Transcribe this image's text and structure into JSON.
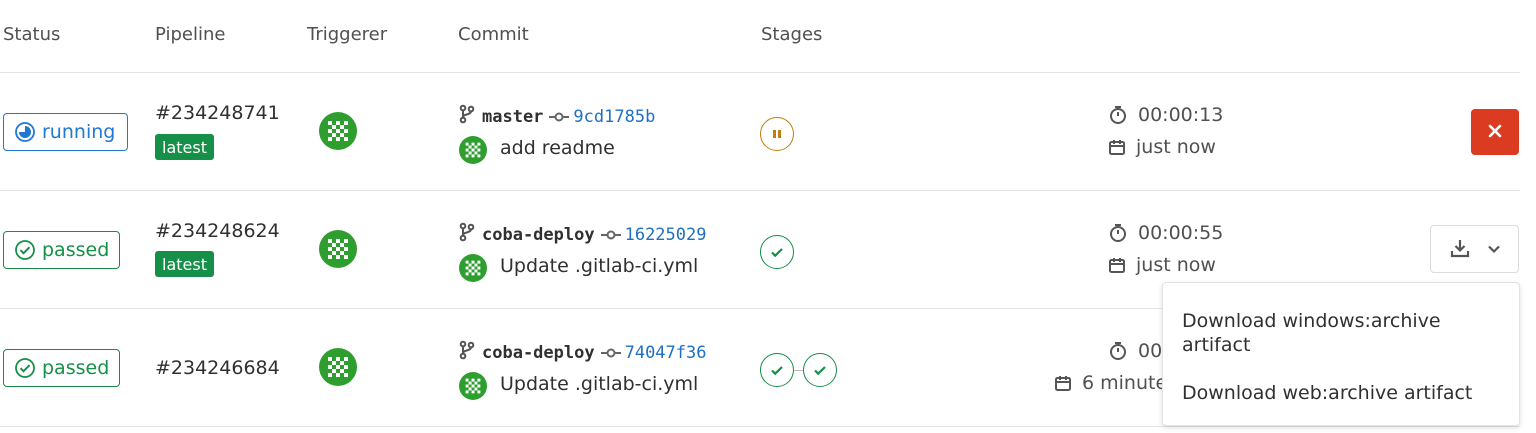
{
  "columns": {
    "status": "Status",
    "pipeline": "Pipeline",
    "triggerer": "Triggerer",
    "commit": "Commit",
    "stages": "Stages"
  },
  "rows": [
    {
      "status": "running",
      "pipeline_id": "#234248741",
      "badge": "latest",
      "branch": "master",
      "sha": "9cd1785b",
      "message": "add readme",
      "stages": [
        "paused"
      ],
      "duration": "00:00:13",
      "finished": "just now",
      "action": "cancel"
    },
    {
      "status": "passed",
      "pipeline_id": "#234248624",
      "badge": "latest",
      "branch": "coba-deploy",
      "sha": "16225029",
      "message": "Update .gitlab-ci.yml",
      "stages": [
        "success"
      ],
      "duration": "00:00:55",
      "finished": "just now",
      "action": "download"
    },
    {
      "status": "passed",
      "pipeline_id": "#234246684",
      "badge": "",
      "branch": "coba-deploy",
      "sha": "74047f36",
      "message": "Update .gitlab-ci.yml",
      "stages": [
        "success",
        "success"
      ],
      "duration": "00",
      "finished": "6 minute"
    }
  ],
  "dropdown": {
    "items": [
      "Download windows:archive artifact",
      "Download web:archive artifact"
    ]
  },
  "colors": {
    "running": "#1f78d1",
    "passed": "#168f48",
    "cancel": "#db3b21",
    "sha_link": "#1f6fc4",
    "paused": "#c17d10"
  },
  "icons": {
    "running": "running-status-icon",
    "passed": "check-circle-icon",
    "branch": "branch-icon",
    "commit": "commit-icon",
    "timer": "stopwatch-icon",
    "calendar": "calendar-icon",
    "cancel": "close-icon",
    "download": "download-icon",
    "caret": "chevron-down-icon"
  }
}
